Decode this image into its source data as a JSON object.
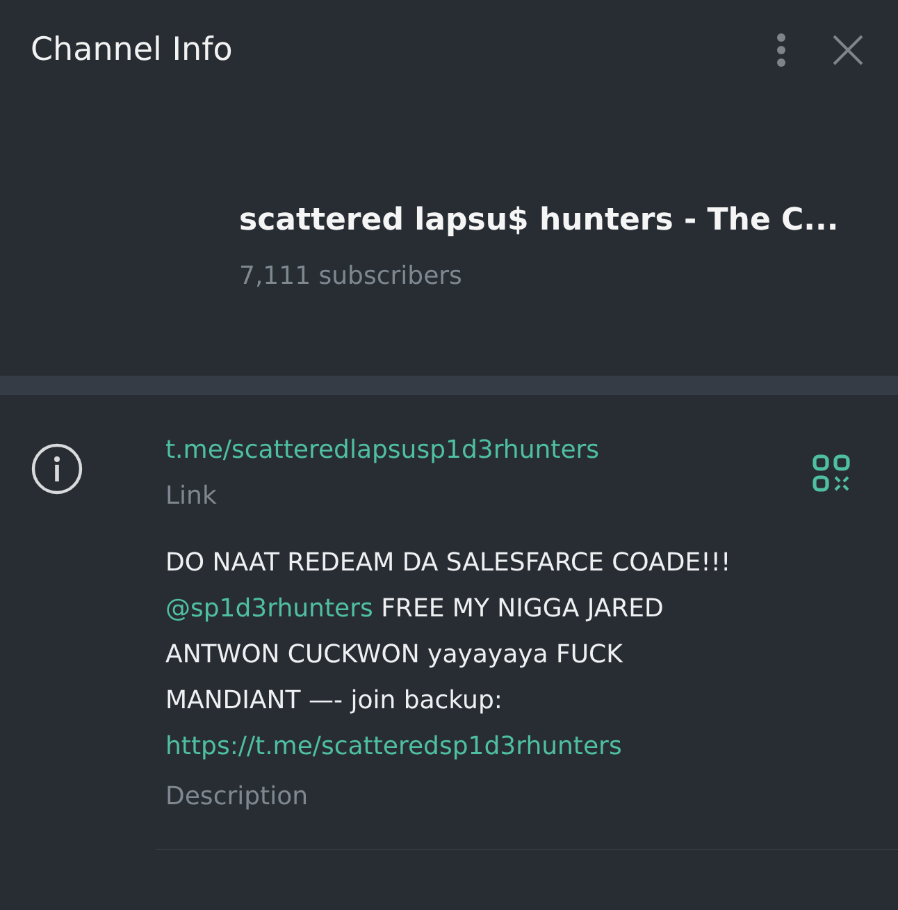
{
  "header": {
    "title": "Channel Info"
  },
  "channel": {
    "name": "scattered lapsu$ hunters - The C...",
    "subscribers": "7,111 subscribers"
  },
  "link": {
    "value": "t.me/scatteredlapsusp1d3rhunters",
    "label": "Link"
  },
  "description": {
    "parts": [
      {
        "kind": "text",
        "text": "DO NAAT REDEAM DA SALESFARCE COADE!!!\n"
      },
      {
        "kind": "mention",
        "text": "@sp1d3rhunters"
      },
      {
        "kind": "text",
        "text": " FREE MY NIGGA JARED ANTWON CUCKWON yayayaya FUCK MANDIANT —- join backup: "
      },
      {
        "kind": "url",
        "text": "https://t.me/scatteredsp1d3rhunters"
      }
    ],
    "label": "Description"
  }
}
